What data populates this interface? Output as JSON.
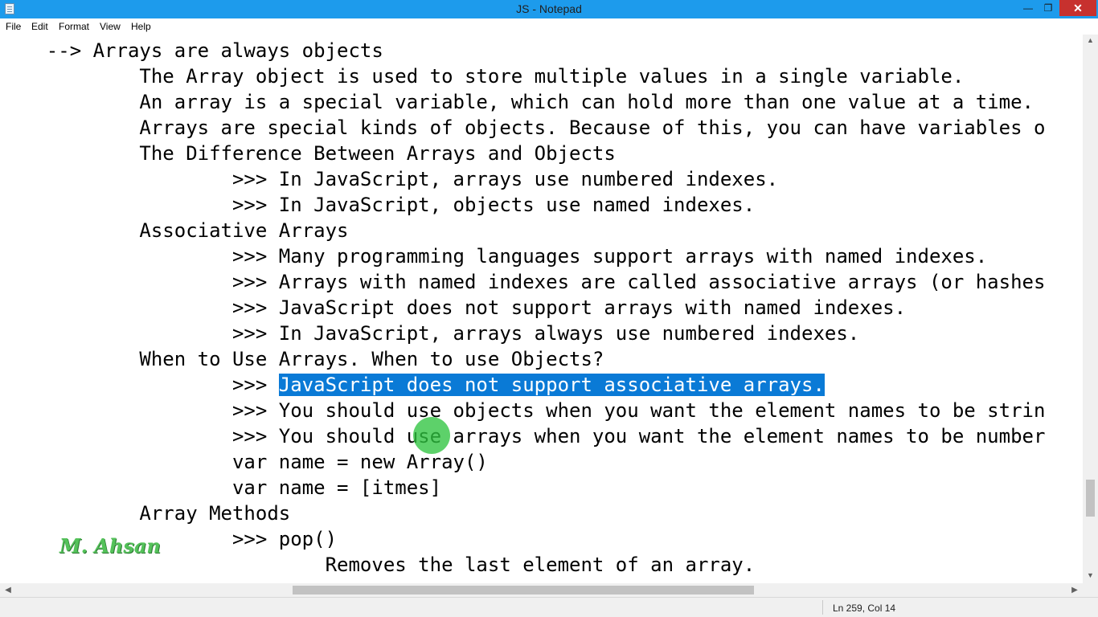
{
  "window": {
    "title": "JS - Notepad",
    "minimize_glyph": "—",
    "maximize_glyph": "❐",
    "close_glyph": "✕",
    "icon": "notepad-icon"
  },
  "menu": [
    "File",
    "Edit",
    "Format",
    "View",
    "Help"
  ],
  "editor": {
    "lines": [
      "    --> Arrays are always objects",
      "            The Array object is used to store multiple values in a single variable.",
      "            An array is a special variable, which can hold more than one value at a time.",
      "            Arrays are special kinds of objects. Because of this, you can have variables o",
      "            The Difference Between Arrays and Objects",
      "                    >>> In JavaScript, arrays use numbered indexes.",
      "                    >>> In JavaScript, objects use named indexes.",
      "            Associative Arrays",
      "                    >>> Many programming languages support arrays with named indexes.",
      "                    >>> Arrays with named indexes are called associative arrays (or hashes",
      "                    >>> JavaScript does not support arrays with named indexes.",
      "                    >>> In JavaScript, arrays always use numbered indexes.",
      "            When to Use Arrays. When to use Objects?",
      "                    >>> ",
      "                    >>> You should use objects when you want the element names to be strin",
      "                    >>> You should use arrays when you want the element names to be number",
      "                    var name = new Array()",
      "                    var name = [itmes]",
      "            Array Methods",
      "                    >>> pop()",
      "                            Removes the last element of an array."
    ],
    "selected_text": "JavaScript does not support associative arrays."
  },
  "watermark": "M. Ahsan",
  "status": {
    "position": "Ln 259, Col 14"
  },
  "scroll": {
    "left_arrow": "◀",
    "right_arrow": "▶",
    "up_arrow": "▲",
    "down_arrow": "▼"
  }
}
